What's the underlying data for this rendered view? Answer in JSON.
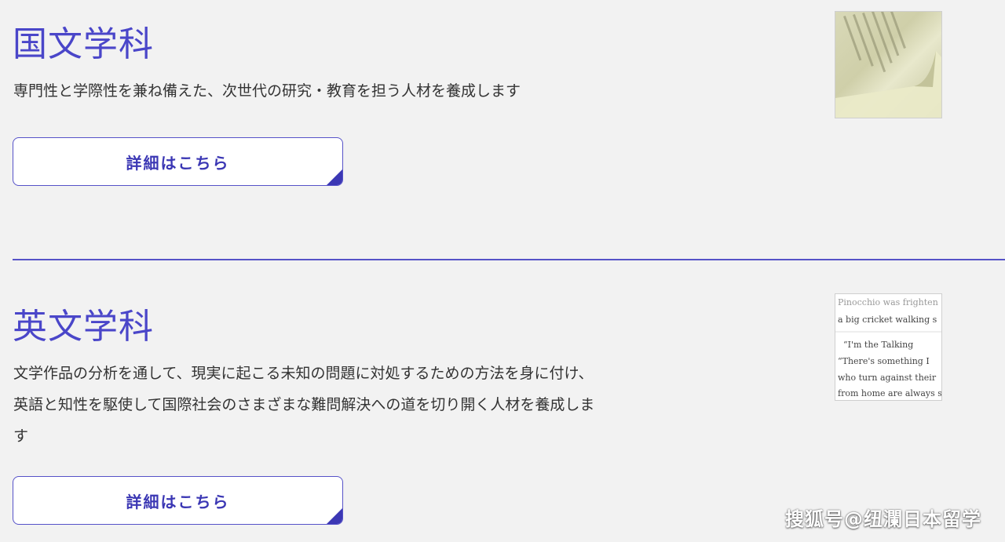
{
  "departments": [
    {
      "title": "国文学科",
      "description": "専門性と学際性を兼ね備えた、次世代の研究・教育を担う人材を養成します",
      "button_label": "詳細はこちら"
    },
    {
      "title": "英文学科",
      "description_lines": [
        "文学作品の分析を通して、現実に起こる未知の問題に対処するための方法を身に付け、",
        "英語と知性を駆使して国際社会のさまざまな難問解決への道を切り開く人材を養成しま",
        "す"
      ],
      "button_label": "詳細はこちら",
      "thumbnail_text": [
        "Pinocchio was frighten",
        "a big cricket walking s",
        "“I'm the Talking",
        "“There's something I",
        "who turn against their",
        "from home are always s"
      ]
    }
  ],
  "colors": {
    "accent": "#4a46c9",
    "button_text": "#3b37b4",
    "background": "#f2f2f2"
  },
  "watermark": "搜狐号@纽瀾日本留学"
}
